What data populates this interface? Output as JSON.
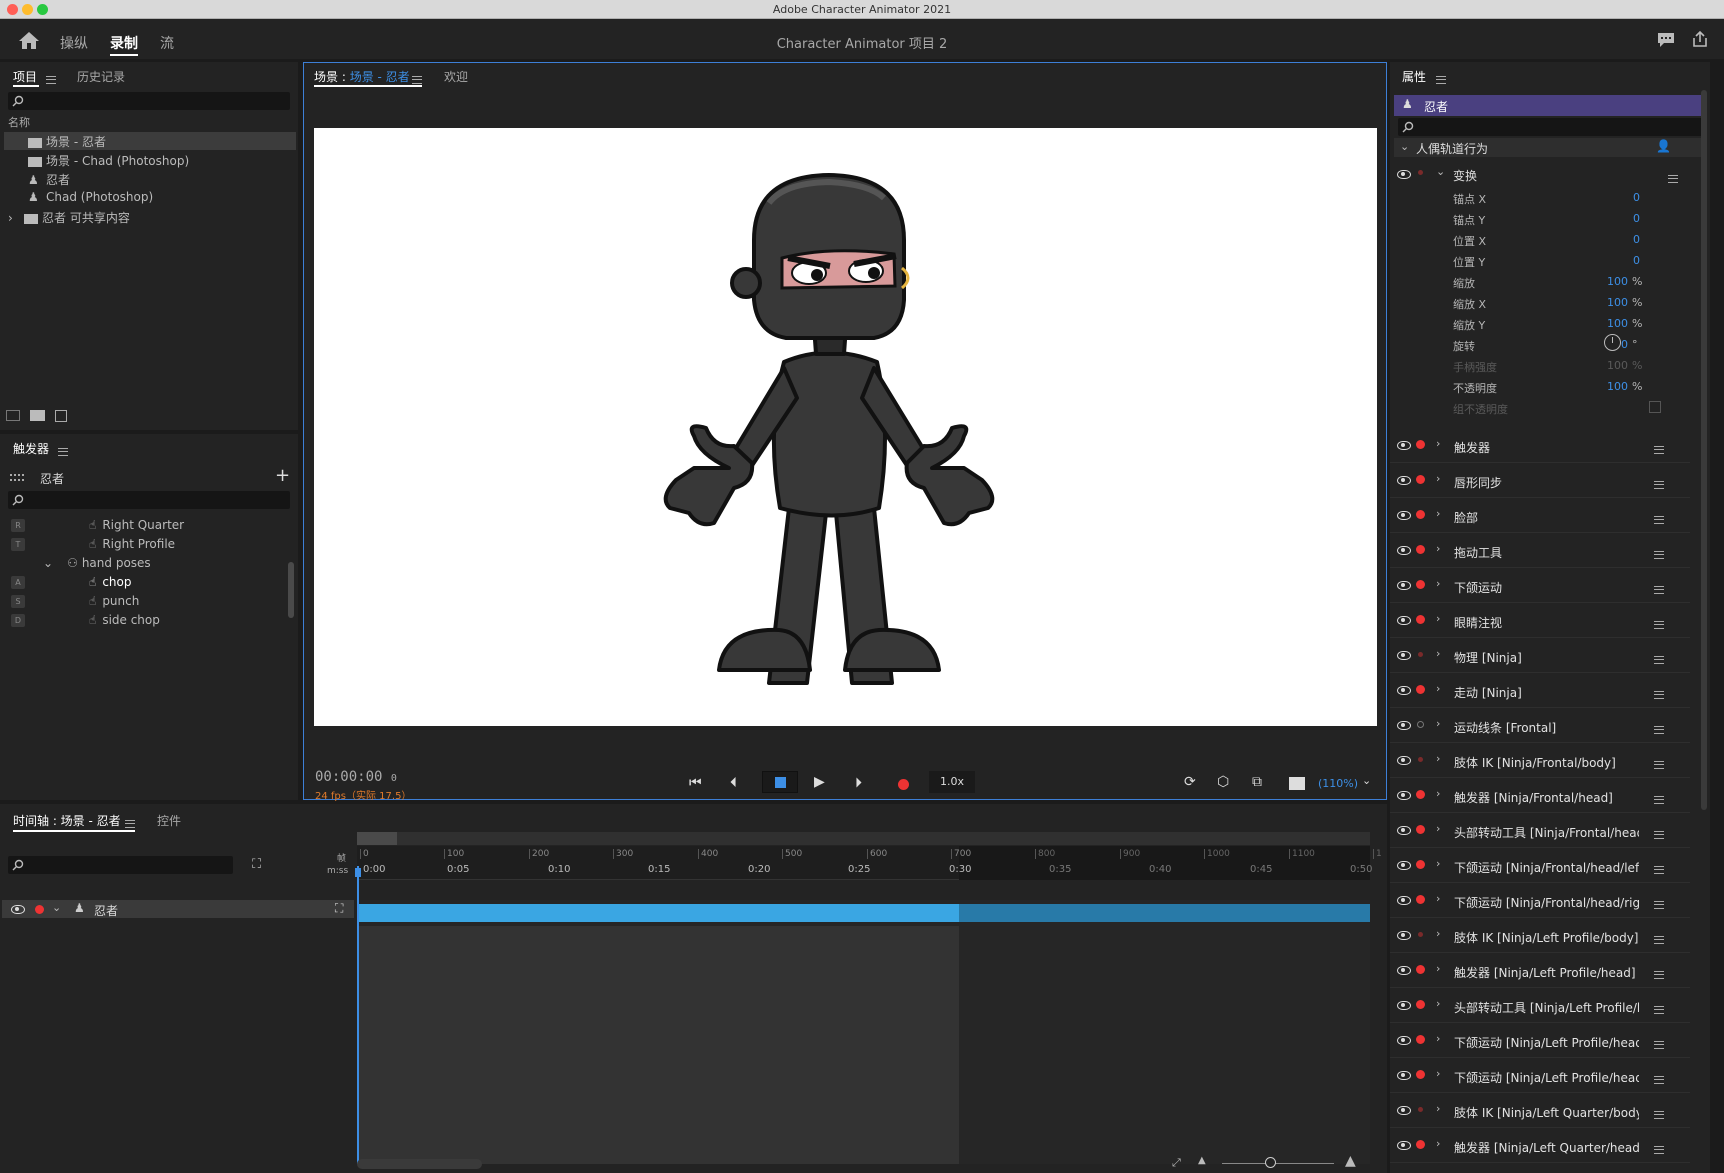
{
  "window": {
    "title": "Adobe Character Animator 2021",
    "project_title": "Character Animator 项目 2"
  },
  "workspaces": [
    {
      "label": "操纵"
    },
    {
      "label": "录制"
    },
    {
      "label": "流"
    }
  ],
  "project_panel": {
    "tabs": [
      {
        "label": "项目"
      },
      {
        "label": "历史记录"
      }
    ],
    "column_header": "名称",
    "items": [
      {
        "label": "场景 - 忍者",
        "icon": "scene-icon"
      },
      {
        "label": "场景 - Chad (Photoshop)",
        "icon": "scene-icon"
      },
      {
        "label": "忍者",
        "icon": "puppet-icon"
      },
      {
        "label": "Chad (Photoshop)",
        "icon": "puppet-icon"
      },
      {
        "label": "忍者 可共享内容",
        "icon": "folder-icon"
      }
    ]
  },
  "triggers_panel": {
    "title": "触发器",
    "puppet": "忍者",
    "items": [
      {
        "key": "R",
        "label": "Right Quarter"
      },
      {
        "key": "T",
        "label": "Right Profile"
      },
      {
        "key": "",
        "label": "hand poses"
      },
      {
        "key": "A",
        "label": "chop"
      },
      {
        "key": "S",
        "label": "punch"
      },
      {
        "key": "D",
        "label": "side chop"
      }
    ]
  },
  "scene_panel": {
    "tabs": [
      {
        "label": "场景 : "
      },
      {
        "label": "场景 - 忍者"
      },
      {
        "label": "欢迎"
      }
    ],
    "timecode": "00:00:00",
    "frame": "0",
    "fps": "24 fps（实际 17.5）",
    "speed": "1.0x",
    "zoom": "(110%)"
  },
  "timeline": {
    "tabs": [
      {
        "label": "时间轴 : 场景 - 忍者"
      },
      {
        "label": "控件"
      }
    ],
    "frame_label": "帧",
    "time_label": "m:ss",
    "frame_ticks": [
      "0",
      "100",
      "200",
      "300",
      "400",
      "500",
      "600",
      "700",
      "800",
      "900",
      "1000",
      "1100",
      "1"
    ],
    "time_ticks": [
      "0:00",
      "0:05",
      "0:10",
      "0:15",
      "0:20",
      "0:25",
      "0:30",
      "0:35",
      "0:40",
      "0:45",
      "0:50"
    ],
    "track": "忍者"
  },
  "properties_panel": {
    "title": "属性",
    "puppet": "忍者",
    "section": "人偶轨道行为",
    "transform_group": "变换",
    "transform": [
      {
        "label": "锚点 X",
        "value": "0",
        "unit": ""
      },
      {
        "label": "锚点 Y",
        "value": "0",
        "unit": ""
      },
      {
        "label": "位置 X",
        "value": "0",
        "unit": ""
      },
      {
        "label": "位置 Y",
        "value": "0",
        "unit": ""
      },
      {
        "label": "缩放",
        "value": "100",
        "unit": "%"
      },
      {
        "label": "缩放 X",
        "value": "100",
        "unit": "%"
      },
      {
        "label": "缩放 Y",
        "value": "100",
        "unit": "%"
      },
      {
        "label": "旋转",
        "value": "0",
        "unit": "°"
      },
      {
        "label": "手柄强度",
        "value": "100",
        "unit": "%"
      },
      {
        "label": "不透明度",
        "value": "100",
        "unit": "%"
      },
      {
        "label": "组不透明度",
        "value": "",
        "unit": ""
      }
    ],
    "behaviors": [
      {
        "label": "触发器"
      },
      {
        "label": "唇形同步"
      },
      {
        "label": "脸部"
      },
      {
        "label": "拖动工具"
      },
      {
        "label": "下颌运动"
      },
      {
        "label": "眼睛注视"
      },
      {
        "label": "物理 [Ninja]"
      },
      {
        "label": "走动 [Ninja]"
      },
      {
        "label": "运动线条 [Frontal]"
      },
      {
        "label": "肢体 IK [Ninja/Frontal/body]"
      },
      {
        "label": "触发器 [Ninja/Frontal/head]"
      },
      {
        "label": "头部转动工具 [Ninja/Frontal/head]"
      },
      {
        "label": "下颌运动 [Ninja/Frontal/head/left p..."
      },
      {
        "label": "下颌运动 [Ninja/Frontal/head/right..."
      },
      {
        "label": "肢体 IK [Ninja/Left Profile/body]"
      },
      {
        "label": "触发器 [Ninja/Left Profile/head]"
      },
      {
        "label": "头部转动工具 [Ninja/Left Profile/h..."
      },
      {
        "label": "下颌运动 [Ninja/Left Profile/head/le..."
      },
      {
        "label": "下颌运动 [Ninja/Left Profile/head/r..."
      },
      {
        "label": "肢体 IK [Ninja/Left Quarter/body]"
      },
      {
        "label": "触发器 [Ninja/Left Quarter/head]"
      }
    ]
  },
  "colors": {
    "accent": "#3d8fe6",
    "record": "#e33333",
    "track": "#3aa6e3",
    "selection": "#4a4080"
  }
}
